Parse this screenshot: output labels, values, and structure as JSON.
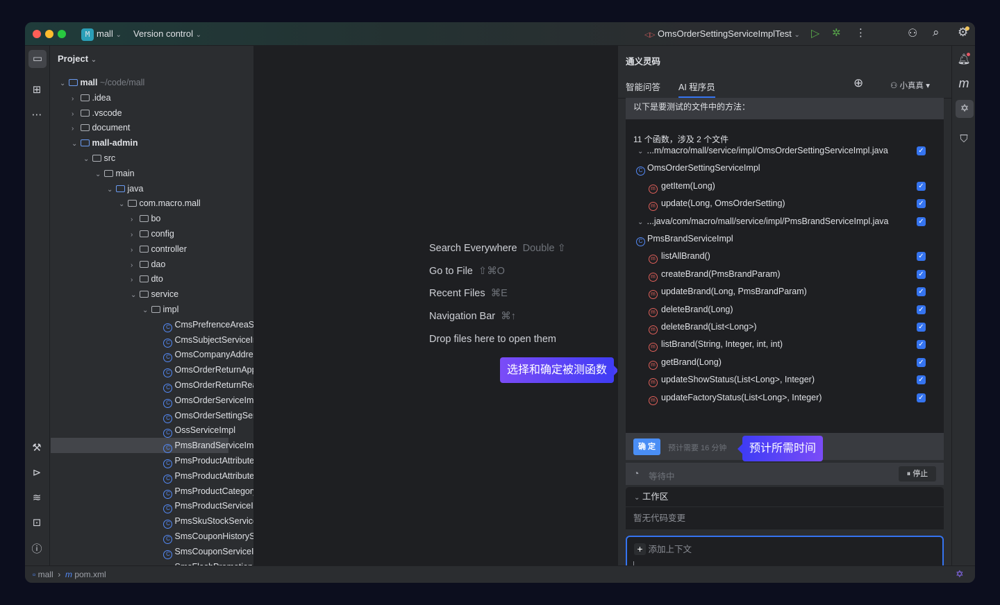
{
  "titlebar": {
    "project_badge": "M",
    "project": "mall",
    "vcs": "Version control",
    "run_config": "OmsOrderSettingServiceImplTest"
  },
  "project_panel": {
    "title": "Project",
    "tree": [
      {
        "label": "mall",
        "suffix": "~/code/mall",
        "depth": 0,
        "kind": "module",
        "open": true,
        "bold": true
      },
      {
        "label": ".idea",
        "depth": 1,
        "kind": "folder",
        "open": false
      },
      {
        "label": ".vscode",
        "depth": 1,
        "kind": "folder",
        "open": false
      },
      {
        "label": "document",
        "depth": 1,
        "kind": "folder",
        "open": false
      },
      {
        "label": "mall-admin",
        "depth": 1,
        "kind": "module",
        "open": true,
        "bold": true
      },
      {
        "label": "src",
        "depth": 2,
        "kind": "folder",
        "open": true
      },
      {
        "label": "main",
        "depth": 3,
        "kind": "folder",
        "open": true
      },
      {
        "label": "java",
        "depth": 4,
        "kind": "source",
        "open": true
      },
      {
        "label": "com.macro.mall",
        "depth": 5,
        "kind": "package",
        "open": true
      },
      {
        "label": "bo",
        "depth": 6,
        "kind": "package",
        "open": false
      },
      {
        "label": "config",
        "depth": 6,
        "kind": "package",
        "open": false
      },
      {
        "label": "controller",
        "depth": 6,
        "kind": "package",
        "open": false
      },
      {
        "label": "dao",
        "depth": 6,
        "kind": "package",
        "open": false
      },
      {
        "label": "dto",
        "depth": 6,
        "kind": "package",
        "open": false
      },
      {
        "label": "service",
        "depth": 6,
        "kind": "package",
        "open": true
      },
      {
        "label": "impl",
        "depth": 7,
        "kind": "package",
        "open": true
      },
      {
        "label": "CmsPrefrenceAreaServiceImpl",
        "depth": 8,
        "kind": "class"
      },
      {
        "label": "CmsSubjectServiceImpl",
        "depth": 8,
        "kind": "class"
      },
      {
        "label": "OmsCompanyAddressServiceImpl",
        "depth": 8,
        "kind": "class"
      },
      {
        "label": "OmsOrderReturnApplyServiceImpl",
        "depth": 8,
        "kind": "class"
      },
      {
        "label": "OmsOrderReturnReasonServiceImpl",
        "depth": 8,
        "kind": "class"
      },
      {
        "label": "OmsOrderServiceImpl",
        "depth": 8,
        "kind": "class"
      },
      {
        "label": "OmsOrderSettingServiceImpl",
        "depth": 8,
        "kind": "class"
      },
      {
        "label": "OssServiceImpl",
        "depth": 8,
        "kind": "class"
      },
      {
        "label": "PmsBrandServiceImpl",
        "depth": 8,
        "kind": "class",
        "selected": true
      },
      {
        "label": "PmsProductAttributeCategoryServiceImpl",
        "depth": 8,
        "kind": "class"
      },
      {
        "label": "PmsProductAttributeServiceImpl",
        "depth": 8,
        "kind": "class"
      },
      {
        "label": "PmsProductCategoryServiceImpl",
        "depth": 8,
        "kind": "class"
      },
      {
        "label": "PmsProductServiceImpl",
        "depth": 8,
        "kind": "class"
      },
      {
        "label": "PmsSkuStockServiceImpl",
        "depth": 8,
        "kind": "class"
      },
      {
        "label": "SmsCouponHistoryServiceImpl",
        "depth": 8,
        "kind": "class"
      },
      {
        "label": "SmsCouponServiceImpl",
        "depth": 8,
        "kind": "class"
      },
      {
        "label": "SmsFlashPromotionServiceImpl",
        "depth": 8,
        "kind": "class"
      }
    ]
  },
  "editor": {
    "hints": [
      {
        "label": "Search Everywhere",
        "shortcut": "Double ⇧"
      },
      {
        "label": "Go to File",
        "shortcut": "⇧⌘O"
      },
      {
        "label": "Recent Files",
        "shortcut": "⌘E"
      },
      {
        "label": "Navigation Bar",
        "shortcut": "⌘↑"
      },
      {
        "label": "Drop files here to open them",
        "shortcut": ""
      }
    ],
    "callout": "选择和确定被测函数"
  },
  "ai_panel": {
    "title": "通义灵码",
    "tabs": [
      "智能问答",
      "AI 程序员"
    ],
    "active_tab": 1,
    "user": "小真真",
    "intro": "以下是要测试的文件中的方法：",
    "summary": "11 个函数，涉及 2 个文件",
    "items": [
      {
        "type": "file",
        "label": "...m/macro/mall/service/impl/OmsOrderSettingServiceImpl.java",
        "checked": true
      },
      {
        "type": "class",
        "label": "OmsOrderSettingServiceImpl"
      },
      {
        "type": "method",
        "label": "getItem(Long)",
        "checked": true
      },
      {
        "type": "method",
        "label": "update(Long, OmsOrderSetting)",
        "checked": true
      },
      {
        "type": "file",
        "label": "...java/com/macro/mall/service/impl/PmsBrandServiceImpl.java",
        "checked": true
      },
      {
        "type": "class",
        "label": "PmsBrandServiceImpl"
      },
      {
        "type": "method",
        "label": "listAllBrand()",
        "checked": true
      },
      {
        "type": "method",
        "label": "createBrand(PmsBrandParam)",
        "checked": true
      },
      {
        "type": "method",
        "label": "updateBrand(Long, PmsBrandParam)",
        "checked": true
      },
      {
        "type": "method",
        "label": "deleteBrand(Long)",
        "checked": true
      },
      {
        "type": "method",
        "label": "deleteBrand(List<Long>)",
        "checked": true
      },
      {
        "type": "method",
        "label": "listBrand(String, Integer, int, int)",
        "checked": true
      },
      {
        "type": "method",
        "label": "getBrand(Long)",
        "checked": true
      },
      {
        "type": "method",
        "label": "updateShowStatus(List<Long>, Integer)",
        "checked": true
      },
      {
        "type": "method",
        "label": "updateFactoryStatus(List<Long>, Integer)",
        "checked": true
      }
    ],
    "confirm": "确 定",
    "estimate": "预计需要 16 分钟",
    "callout": "预计所需时间",
    "status": "等待中",
    "stop": "停止",
    "workspace": "工作区",
    "no_changes": "暂无代码变更",
    "add_context": "添加上下文"
  },
  "statusbar": {
    "crumbs": [
      "mall",
      "pom.xml"
    ]
  },
  "colors": {
    "accent": "#3574f0",
    "callout_start": "#7b4cf7",
    "callout_end": "#3f3cf5"
  }
}
